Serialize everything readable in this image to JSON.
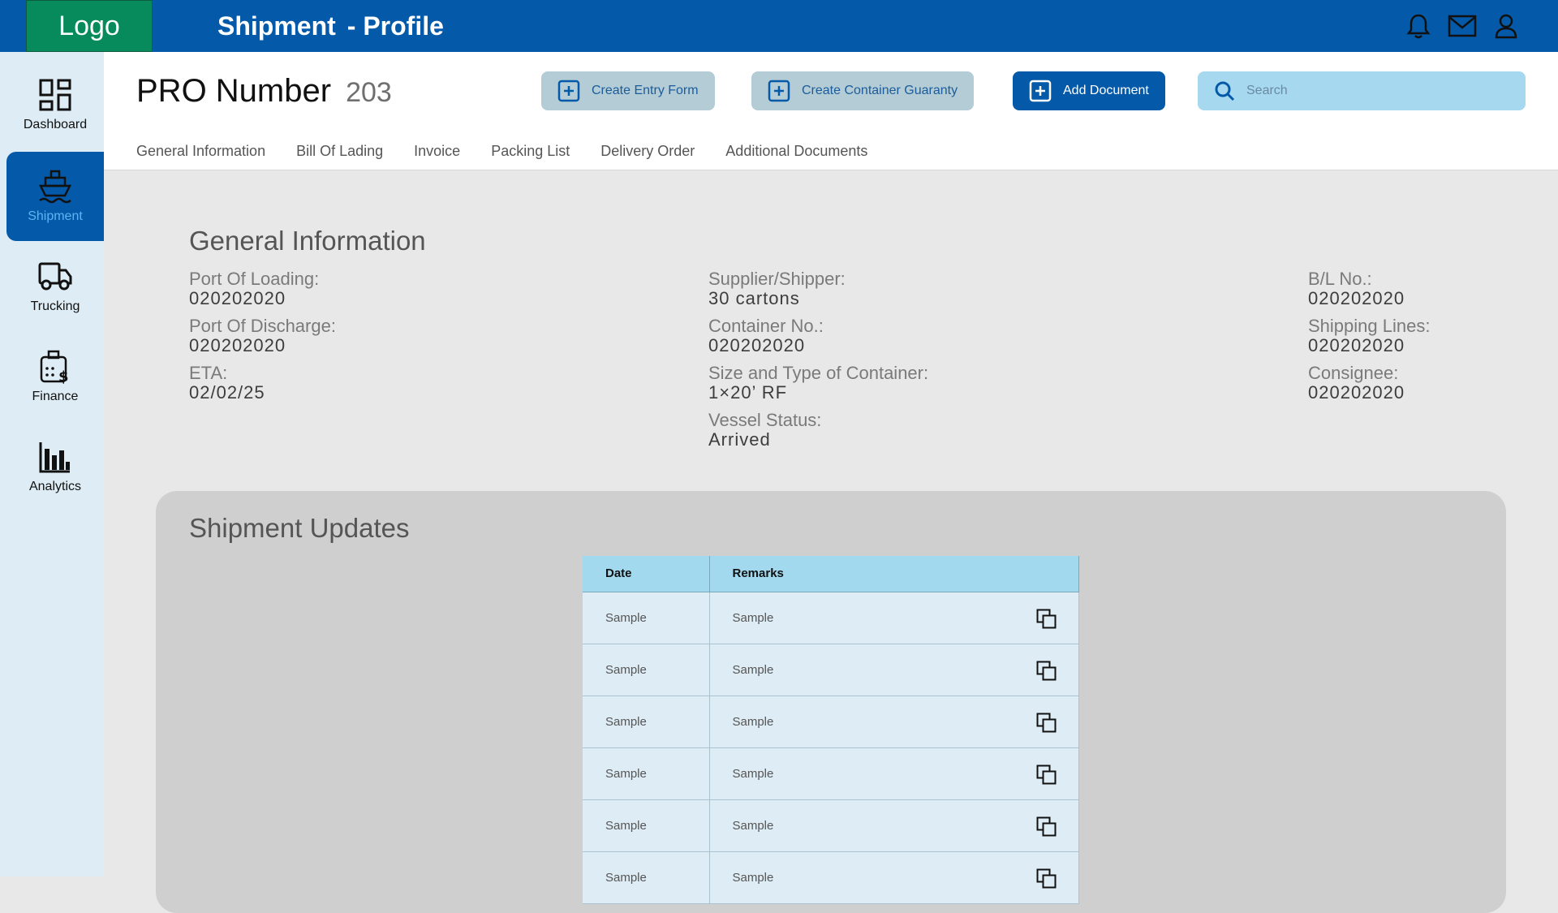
{
  "topbar": {
    "logo": "Logo",
    "title": "Shipment",
    "subtitle": "- Profile",
    "icons": [
      "bell-icon",
      "mail-icon",
      "user-icon"
    ]
  },
  "sidebar": {
    "items": [
      {
        "label": "Dashboard",
        "icon": "dashboard-icon"
      },
      {
        "label": "Shipment",
        "icon": "ship-icon",
        "active": true
      },
      {
        "label": "Trucking",
        "icon": "truck-icon"
      },
      {
        "label": "Finance",
        "icon": "finance-icon"
      },
      {
        "label": "Analytics",
        "icon": "analytics-icon"
      }
    ]
  },
  "header": {
    "title": "PRO Number",
    "number": "203",
    "buttons": {
      "create_entry": "Create Entry Form",
      "create_container": "Create Container Guaranty",
      "add_document": "Add Document"
    },
    "search_placeholder": "Search",
    "tabs": [
      "General Information",
      "Bill Of Lading",
      "Invoice",
      "Packing List",
      "Delivery Order",
      "Additional Documents"
    ]
  },
  "general_info": {
    "title": "General Information",
    "col1": [
      {
        "label": "Port Of Loading:",
        "value": "020202020"
      },
      {
        "label": "Port Of Discharge:",
        "value": "020202020"
      },
      {
        "label": "ETA:",
        "value": "02/02/25"
      }
    ],
    "col2": [
      {
        "label": "Supplier/Shipper:",
        "value": "30 cartons"
      },
      {
        "label": "Container No.:",
        "value": "020202020"
      },
      {
        "label": "Size and Type of Container:",
        "value": "1×20’ RF"
      },
      {
        "label": "Vessel Status:",
        "value": "Arrived"
      }
    ],
    "col3": [
      {
        "label": "B/L No.:",
        "value": "020202020"
      },
      {
        "label": "Shipping Lines:",
        "value": "020202020"
      },
      {
        "label": "Consignee:",
        "value": "020202020"
      }
    ]
  },
  "updates": {
    "title": "Shipment Updates",
    "columns": [
      "Date",
      "Remarks"
    ],
    "rows": [
      {
        "date": "Sample",
        "remarks": "Sample"
      },
      {
        "date": "Sample",
        "remarks": "Sample"
      },
      {
        "date": "Sample",
        "remarks": "Sample"
      },
      {
        "date": "Sample",
        "remarks": "Sample"
      },
      {
        "date": "Sample",
        "remarks": "Sample"
      },
      {
        "date": "Sample",
        "remarks": "Sample"
      }
    ]
  },
  "colors": {
    "primary": "#0559a9",
    "logo": "#078a5c",
    "sidebar": "#deedf5",
    "table_header": "#a2d9ee"
  }
}
